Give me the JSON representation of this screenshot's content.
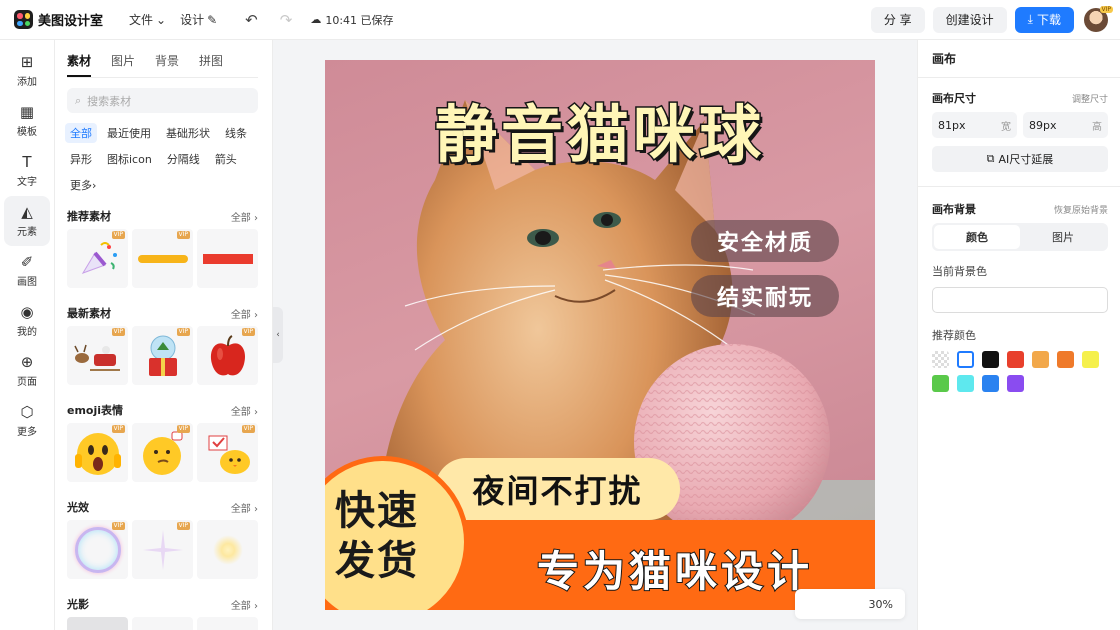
{
  "app": {
    "name": "美图设计室"
  },
  "topbar": {
    "menu_file": "文件",
    "menu_design": "设计",
    "save_state": "10:41 已保存",
    "share": "分 享",
    "create": "创建设计",
    "download": "下载",
    "avatar_badge": "VIP"
  },
  "leftnav": {
    "items": [
      {
        "label": "添加",
        "icon": "plus-square-icon"
      },
      {
        "label": "模板",
        "icon": "template-icon"
      },
      {
        "label": "文字",
        "icon": "text-icon"
      },
      {
        "label": "元素",
        "icon": "shapes-icon"
      },
      {
        "label": "画图",
        "icon": "pen-icon"
      },
      {
        "label": "我的",
        "icon": "user-icon"
      },
      {
        "label": "页面",
        "icon": "page-add-icon"
      },
      {
        "label": "更多",
        "icon": "cube-icon"
      }
    ],
    "active_index": 3
  },
  "panel": {
    "tabs": [
      "素材",
      "图片",
      "背景",
      "拼图"
    ],
    "active_tab": 0,
    "search_placeholder": "搜索素材",
    "categories": [
      "全部",
      "最近使用",
      "基础形状",
      "线条",
      "异形",
      "图标icon",
      "分隔线",
      "箭头",
      "更多"
    ],
    "sections": [
      {
        "title": "推荐素材",
        "more": "全部"
      },
      {
        "title": "最新素材",
        "more": "全部"
      },
      {
        "title": "emoji表情",
        "more": "全部"
      },
      {
        "title": "光效",
        "more": "全部"
      },
      {
        "title": "光影",
        "more": "全部"
      }
    ],
    "vip_badge": "VIP"
  },
  "canvas": {
    "title": "静音猫咪球",
    "pill_1": "安全材质",
    "pill_2": "结实耐玩",
    "tagline": "夜间不打扰",
    "slogan": "专为猫咪设计",
    "circle_text": "快速发货",
    "zoom": "30%"
  },
  "rpanel": {
    "title": "画布",
    "size_label": "画布尺寸",
    "size_action": "调整尺寸",
    "width_value": "81px",
    "width_unit": "宽",
    "height_value": "89px",
    "height_unit": "高",
    "ai_button": "AI尺寸延展",
    "bg_label": "画布背景",
    "bg_action": "恢复原始背景",
    "seg_color": "颜色",
    "seg_image": "图片",
    "current_bg_label": "当前背景色",
    "recommend_label": "推荐颜色",
    "swatches": [
      "transparent",
      "#ffffff",
      "#111111",
      "#e8402c",
      "#f2a84a",
      "#ef7a2a",
      "#f5f04c",
      "#5ac94a",
      "#5ee8ee",
      "#2a82f0",
      "#8a4cf0"
    ]
  }
}
